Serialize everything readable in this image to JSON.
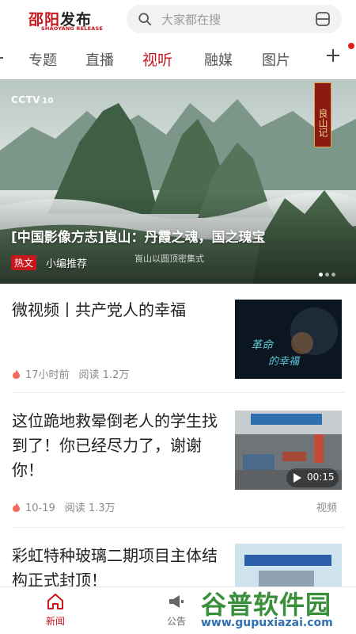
{
  "header": {
    "logo_cn_first": "邵阳",
    "logo_cn_rest": "发布",
    "logo_en": "SHAOYANG RELEASE",
    "search_placeholder": "大家都在搜"
  },
  "tabs": [
    {
      "label": "专题"
    },
    {
      "label": "直播"
    },
    {
      "label": "视听",
      "active": true
    },
    {
      "label": "融媒"
    },
    {
      "label": "图片"
    }
  ],
  "hero": {
    "channel": "CCTV",
    "channel_num": "10",
    "series_tag": "良山记",
    "title": "[中国影像方志]崀山：丹霞之魂，国之瑰宝",
    "badge": "热文",
    "editor": "小编推荐",
    "caption": "崀山以圆顶密集式"
  },
  "news": [
    {
      "headline": "微视频丨共产党人的幸福",
      "time": "17小时前",
      "reads": "阅读 1.2万",
      "category": ""
    },
    {
      "headline": "这位跪地救晕倒老人的学生找到了！你已经尽力了，谢谢你！",
      "time": "10-19",
      "reads": "阅读 1.3万",
      "category": "视频",
      "duration": "00:15"
    },
    {
      "headline": "彩虹特种玻璃二期项目主体结构正式封顶！",
      "time": "",
      "reads": "",
      "category": ""
    }
  ],
  "bottom_nav": [
    {
      "label": "新闻",
      "icon": "home-icon",
      "active": true
    },
    {
      "label": "公告",
      "icon": "megaphone-icon"
    }
  ],
  "watermark": {
    "big": "谷普软件园",
    "small": "www.gupuxiazai.com"
  },
  "colors": {
    "brand_red": "#c8161d",
    "text": "#222222",
    "muted": "#8a8a8a"
  }
}
